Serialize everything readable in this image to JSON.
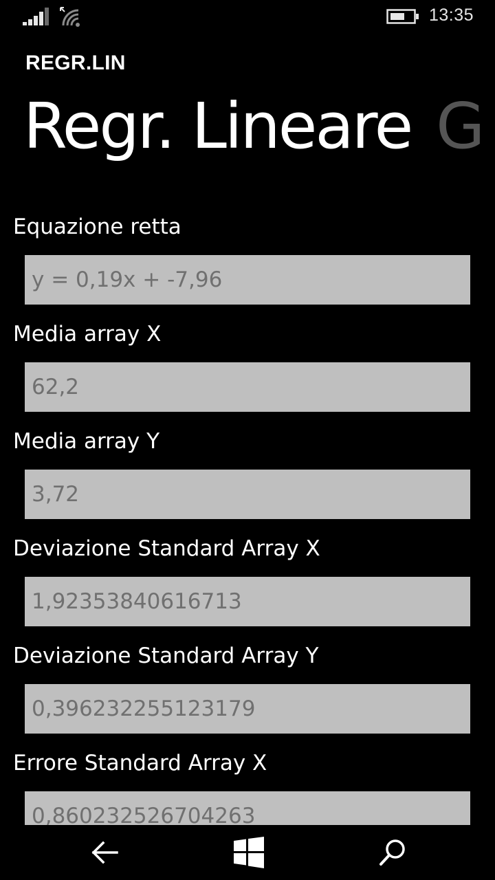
{
  "status_bar": {
    "time": "13:35",
    "signal_icon": "signal-bars-icon",
    "wifi_icon": "wifi-icon",
    "battery_icon": "battery-icon"
  },
  "header": {
    "app_title": "REGR.LIN",
    "pivot_active": "Regr. Lineare",
    "pivot_next": "G"
  },
  "fields": [
    {
      "label": "Equazione retta",
      "value": "y = 0,19x + -7,96"
    },
    {
      "label": "Media array X",
      "value": "62,2"
    },
    {
      "label": "Media array Y",
      "value": "3,72"
    },
    {
      "label": "Deviazione Standard Array X",
      "value": "1,92353840616713"
    },
    {
      "label": "Deviazione Standard Array Y",
      "value": "0,396232255123179"
    },
    {
      "label": "Errore Standard Array X",
      "value": "0,860232526704263"
    }
  ],
  "nav_bar": {
    "back_icon": "back-arrow-icon",
    "home_icon": "windows-logo-icon",
    "search_icon": "search-icon"
  },
  "colors": {
    "background": "#000000",
    "field_background": "#bfbfbf",
    "field_text": "#707070",
    "pivot_inactive": "#555555"
  }
}
